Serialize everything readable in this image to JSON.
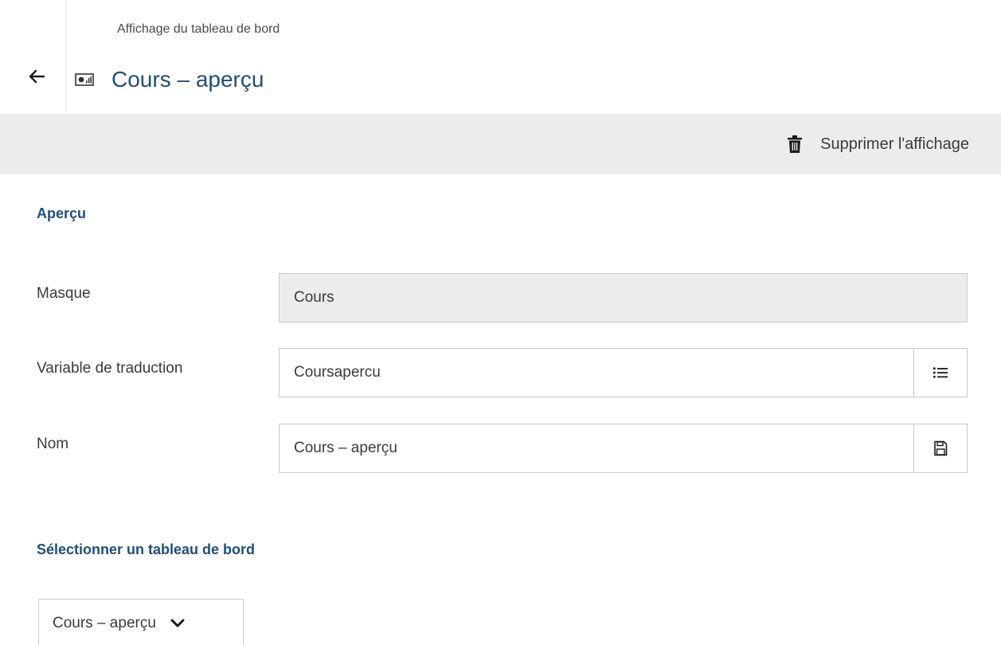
{
  "header": {
    "breadcrumb": "Affichage du tableau de bord",
    "title": "Cours – aperçu"
  },
  "toolbar": {
    "delete_label": "Supprimer l'affichage"
  },
  "overview": {
    "section_title": "Aperçu",
    "fields": {
      "masque": {
        "label": "Masque",
        "value": "Cours"
      },
      "translation_variable": {
        "label": "Variable de traduction",
        "value": "Coursapercu"
      },
      "name": {
        "label": "Nom",
        "value": "Cours – aperçu"
      }
    }
  },
  "dashboard_select": {
    "section_title": "Sélectionner un tableau de bord",
    "selected": "Cours – aperçu"
  },
  "icons": {
    "back": "arrow-left-icon",
    "title": "dashboard-icon",
    "delete": "trash-icon",
    "list": "list-icon",
    "save": "floppy-disk-icon",
    "chevron": "chevron-down-icon"
  },
  "colors": {
    "accent": "#1f4e79",
    "toolbar_bg": "#ececec",
    "readonly_bg": "#ececec"
  }
}
